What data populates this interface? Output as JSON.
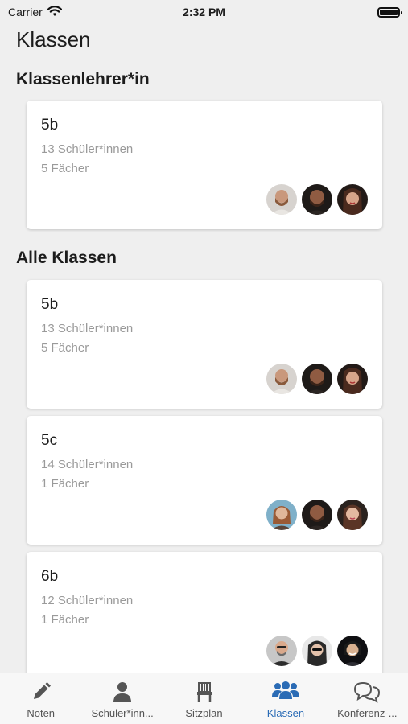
{
  "status_bar": {
    "carrier": "Carrier",
    "time": "2:32 PM"
  },
  "page_title": "Klassen",
  "sections": {
    "homeroom": {
      "title": "Klassenlehrer*in"
    },
    "all": {
      "title": "Alle Klassen"
    }
  },
  "cards": [
    {
      "name": "5b",
      "students": "13 Schüler*innen",
      "subjects": "5 Fächer"
    },
    {
      "name": "5b",
      "students": "13 Schüler*innen",
      "subjects": "5 Fächer"
    },
    {
      "name": "5c",
      "students": "14 Schüler*innen",
      "subjects": "1 Fächer"
    },
    {
      "name": "6b",
      "students": "12 Schüler*innen",
      "subjects": "1 Fächer"
    }
  ],
  "tabs": [
    {
      "label": "Noten",
      "icon": "pencil-icon"
    },
    {
      "label": "Schüler*inn...",
      "icon": "person-icon"
    },
    {
      "label": "Sitzplan",
      "icon": "chair-icon"
    },
    {
      "label": "Klassen",
      "icon": "group-icon"
    },
    {
      "label": "Konferenz-...",
      "icon": "chat-bubbles-icon"
    }
  ],
  "colors": {
    "accent": "#2a6bb5",
    "background": "#efefef",
    "secondary_text": "#9a9a9a"
  }
}
